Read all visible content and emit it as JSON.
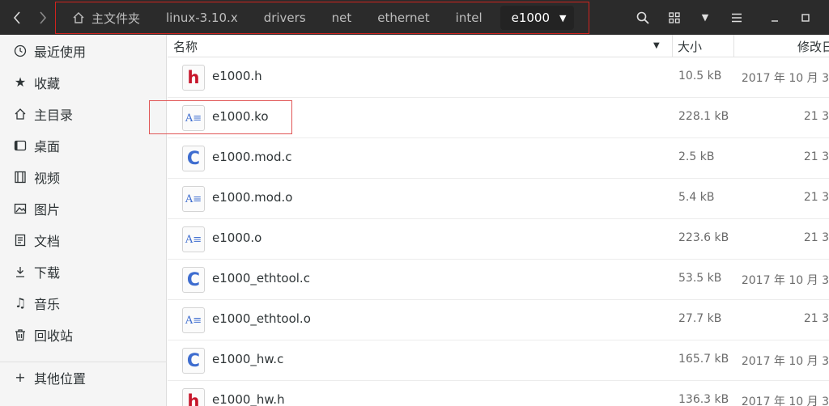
{
  "header": {
    "back_icon": "chevron-left-icon",
    "forward_icon": "chevron-right-icon",
    "breadcrumbs": [
      {
        "label": "主文件夹",
        "icon": "home-icon"
      },
      {
        "label": "linux-3.10.x"
      },
      {
        "label": "drivers"
      },
      {
        "label": "net"
      },
      {
        "label": "ethernet"
      },
      {
        "label": "intel"
      },
      {
        "label": "e1000",
        "current": true
      }
    ],
    "buttons": [
      "search-icon",
      "grid-view-icon",
      "chevron-down-icon",
      "hamburger-menu-icon",
      "minimize-icon",
      "maximize-icon"
    ]
  },
  "sidebar": {
    "items": [
      {
        "label": "最近使用",
        "icon": "clock-icon"
      },
      {
        "label": "收藏",
        "icon": "star-icon"
      },
      {
        "label": "主目录",
        "icon": "home-icon"
      },
      {
        "label": "桌面",
        "icon": "desktop-icon"
      },
      {
        "label": "视频",
        "icon": "video-icon"
      },
      {
        "label": "图片",
        "icon": "picture-icon"
      },
      {
        "label": "文档",
        "icon": "document-icon"
      },
      {
        "label": "下载",
        "icon": "download-icon"
      },
      {
        "label": "音乐",
        "icon": "music-icon"
      },
      {
        "label": "回收站",
        "icon": "trash-icon"
      }
    ],
    "other": {
      "label": "其他位置",
      "icon": "plus-icon"
    }
  },
  "columns": {
    "name": "名称",
    "size": "大小",
    "modified": "修改日"
  },
  "files": [
    {
      "name": "e1000.h",
      "type": "h",
      "size": "10.5 kB",
      "date": "2017 年 10 月 3"
    },
    {
      "name": "e1000.ko",
      "type": "bin",
      "size": "228.1 kB",
      "date": "21 3"
    },
    {
      "name": "e1000.mod.c",
      "type": "c",
      "size": "2.5 kB",
      "date": "21 3"
    },
    {
      "name": "e1000.mod.o",
      "type": "bin",
      "size": "5.4 kB",
      "date": "21 3"
    },
    {
      "name": "e1000.o",
      "type": "bin",
      "size": "223.6 kB",
      "date": "21 3"
    },
    {
      "name": "e1000_ethtool.c",
      "type": "c",
      "size": "53.5 kB",
      "date": "2017 年 10 月 3"
    },
    {
      "name": "e1000_ethtool.o",
      "type": "bin",
      "size": "27.7 kB",
      "date": "21 3"
    },
    {
      "name": "e1000_hw.c",
      "type": "c",
      "size": "165.7 kB",
      "date": "2017 年 10 月 3"
    },
    {
      "name": "e1000_hw.h",
      "type": "h",
      "size": "136.3 kB",
      "date": "2017 年 10 月 3"
    }
  ]
}
